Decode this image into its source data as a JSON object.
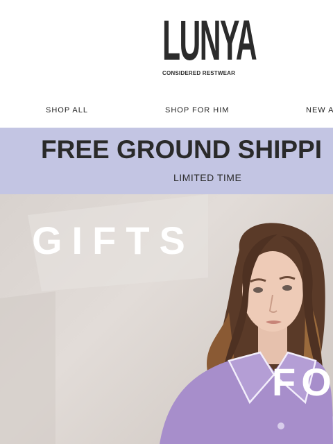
{
  "brand": {
    "name": "LUNYA",
    "tagline": "CONSIDERED RESTWEAR"
  },
  "nav": {
    "items": [
      {
        "label": "SHOP ALL"
      },
      {
        "label": "SHOP FOR HIM"
      },
      {
        "label": "NEW A"
      }
    ]
  },
  "promo": {
    "headline": "FREE GROUND SHIPPI",
    "subtext": "LIMITED TIME",
    "background_color": "#c3c5e3"
  },
  "hero": {
    "word_1": "GIFTS",
    "word_2": "FO",
    "image_description": "woman in lavender satin pajamas"
  }
}
